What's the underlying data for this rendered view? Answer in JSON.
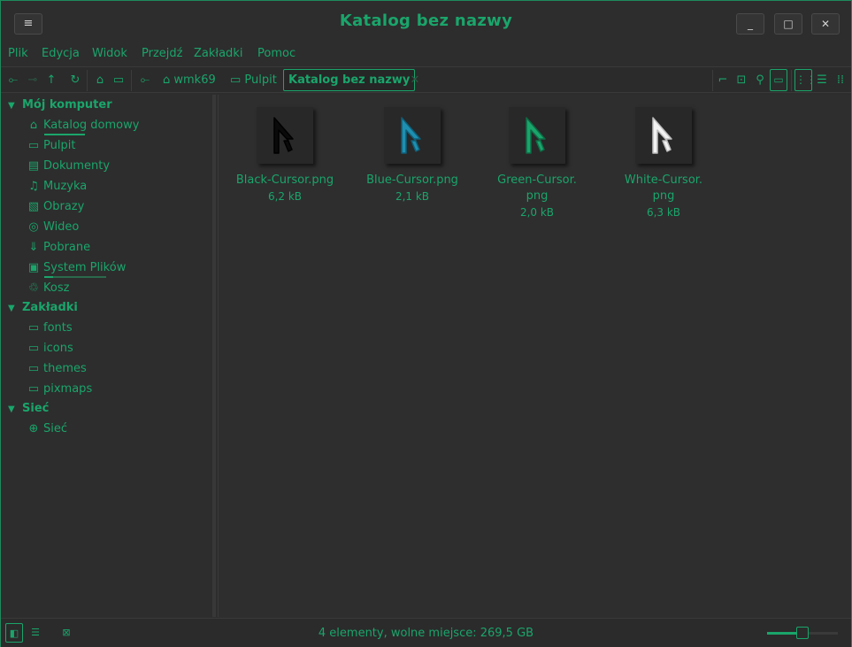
{
  "window": {
    "title": "Katalog bez nazwy",
    "menu_icon": "menu-icon",
    "minimize": "_",
    "maximize": "□",
    "close": "✕"
  },
  "menubar": [
    "Plik",
    "Edycja",
    "Widok",
    "Przejdź",
    "Zakładki",
    "Pomoc"
  ],
  "toolbar": {
    "breadcrumbs": [
      "wmk69",
      "Pulpit"
    ],
    "current": "Katalog bez nazwy"
  },
  "sidebar": {
    "sections": [
      {
        "title": "Mój komputer",
        "items": [
          {
            "label": "Katalog domowy",
            "icon": "home-icon"
          },
          {
            "label": "Pulpit",
            "icon": "desktop-icon"
          },
          {
            "label": "Dokumenty",
            "icon": "documents-icon"
          },
          {
            "label": "Muzyka",
            "icon": "music-icon"
          },
          {
            "label": "Obrazy",
            "icon": "pictures-icon"
          },
          {
            "label": "Wideo",
            "icon": "video-icon"
          },
          {
            "label": "Pobrane",
            "icon": "downloads-icon"
          },
          {
            "label": "System Plików",
            "icon": "filesystem-icon"
          },
          {
            "label": "Kosz",
            "icon": "trash-icon"
          }
        ]
      },
      {
        "title": "Zakładki",
        "items": [
          {
            "label": "fonts",
            "icon": "folder-icon"
          },
          {
            "label": "icons",
            "icon": "folder-icon"
          },
          {
            "label": "themes",
            "icon": "folder-icon"
          },
          {
            "label": "pixmaps",
            "icon": "folder-icon"
          }
        ]
      },
      {
        "title": "Sieć",
        "items": [
          {
            "label": "Sieć",
            "icon": "network-icon"
          }
        ]
      }
    ]
  },
  "files": [
    {
      "name_line1": "Black-Cursor.png",
      "name_line2": "",
      "size": "6,2 kB",
      "color": "#0a0a0a"
    },
    {
      "name_line1": "Blue-Cursor.png",
      "name_line2": "",
      "size": "2,1 kB",
      "color": "#1e8fb0"
    },
    {
      "name_line1": "Green-Cursor.",
      "name_line2": "png",
      "size": "2,0 kB",
      "color": "#1aa56b"
    },
    {
      "name_line1": "White-Cursor.",
      "name_line2": "png",
      "size": "6,3 kB",
      "color": "#f2f2f2"
    }
  ],
  "status": {
    "text": "4 elementy, wolne miejsce: 269,5 GB",
    "zoom_fraction": 0.5
  },
  "colors": {
    "accent": "#1aa56b",
    "background": "#2d2d2d"
  }
}
